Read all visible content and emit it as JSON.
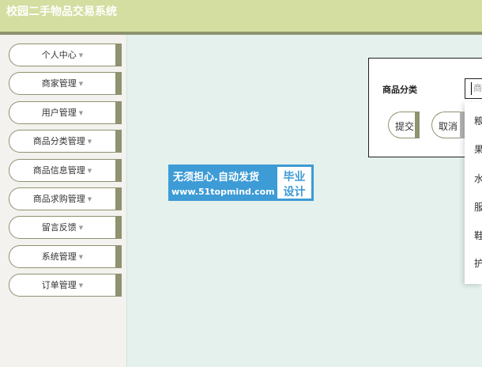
{
  "header": {
    "title": "校园二手物品交易系统"
  },
  "sidebar": {
    "items": [
      {
        "label": "个人中心"
      },
      {
        "label": "商家管理"
      },
      {
        "label": "用户管理"
      },
      {
        "label": "商品分类管理"
      },
      {
        "label": "商品信息管理"
      },
      {
        "label": "商品求购管理"
      },
      {
        "label": "留言反馈"
      },
      {
        "label": "系统管理"
      },
      {
        "label": "订单管理"
      }
    ],
    "caret_glyph": "▼"
  },
  "watermark": {
    "line1": "无须担心.自动发货",
    "line2": "www.51topmind.com",
    "right1": "毕业",
    "right2": "设计"
  },
  "form": {
    "field_label": "商品分类",
    "input_placeholder": "商",
    "submit_label": "提交",
    "cancel_label": "取消"
  },
  "dropdown": {
    "options": [
      "粮",
      "果",
      "水",
      "服",
      "鞋",
      "护"
    ]
  },
  "colors": {
    "header_bg": "#d3dea0",
    "accent": "#8e9370",
    "page_bg": "#e4f1ec",
    "watermark_blue": "#3d9bd6"
  }
}
